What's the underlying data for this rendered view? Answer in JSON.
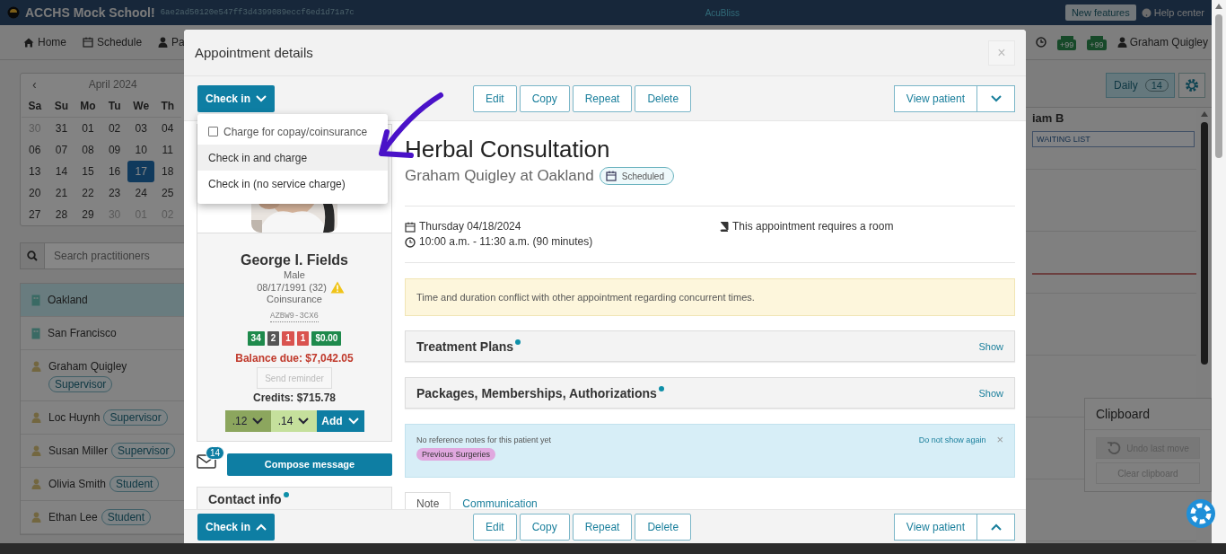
{
  "top_bar": {
    "school": "ACCHS Mock School!",
    "hash": "6ae2ad50120e547ff3d4399089eccf6ed1d71a7c",
    "brand": "AcuBliss",
    "new_features": "New features",
    "help": "Help center"
  },
  "nav": {
    "items": [
      {
        "label": "Home",
        "kind": "home"
      },
      {
        "label": "Schedule",
        "kind": "calendar"
      },
      {
        "label": "Pa",
        "kind": "person"
      }
    ],
    "badges": [
      "+99",
      "+99"
    ],
    "user": "Graham Quigley"
  },
  "calendar": {
    "prev": "‹",
    "month": "April 2024",
    "weekdays": [
      "Sa",
      "Su",
      "Mo",
      "Tu",
      "We",
      "Th"
    ],
    "weeks": [
      [
        {
          "day": "30",
          "muted": true,
          "selected": false
        },
        {
          "day": "31",
          "muted": false,
          "selected": false
        },
        {
          "day": "01",
          "muted": false,
          "selected": false
        },
        {
          "day": "02",
          "muted": false,
          "selected": false
        },
        {
          "day": "03",
          "muted": false,
          "selected": false
        },
        {
          "day": "04",
          "muted": false,
          "selected": false
        }
      ],
      [
        {
          "day": "06",
          "muted": false,
          "selected": false
        },
        {
          "day": "07",
          "muted": false,
          "selected": false
        },
        {
          "day": "08",
          "muted": false,
          "selected": false
        },
        {
          "day": "09",
          "muted": false,
          "selected": false
        },
        {
          "day": "10",
          "muted": false,
          "selected": false
        },
        {
          "day": "11",
          "muted": false,
          "selected": false
        }
      ],
      [
        {
          "day": "13",
          "muted": false,
          "selected": false
        },
        {
          "day": "14",
          "muted": false,
          "selected": false
        },
        {
          "day": "15",
          "muted": false,
          "selected": false
        },
        {
          "day": "16",
          "muted": false,
          "selected": false
        },
        {
          "day": "17",
          "muted": false,
          "selected": true
        },
        {
          "day": "18",
          "muted": false,
          "selected": false
        }
      ],
      [
        {
          "day": "20",
          "muted": false,
          "selected": false
        },
        {
          "day": "21",
          "muted": false,
          "selected": false
        },
        {
          "day": "22",
          "muted": false,
          "selected": false
        },
        {
          "day": "23",
          "muted": false,
          "selected": false
        },
        {
          "day": "24",
          "muted": false,
          "selected": false
        },
        {
          "day": "25",
          "muted": false,
          "selected": false
        }
      ],
      [
        {
          "day": "27",
          "muted": false,
          "selected": false
        },
        {
          "day": "28",
          "muted": false,
          "selected": false
        },
        {
          "day": "29",
          "muted": false,
          "selected": false
        },
        {
          "day": "30",
          "muted": true,
          "selected": false
        },
        {
          "day": "01",
          "muted": true,
          "selected": false
        },
        {
          "day": "02",
          "muted": true,
          "selected": false
        }
      ]
    ]
  },
  "search": {
    "placeholder": "Search practitioners"
  },
  "practitioners": [
    {
      "name": "Oakland",
      "kind": "location",
      "selected": true
    },
    {
      "name": "San Francisco",
      "kind": "location",
      "selected": false
    },
    {
      "name": "Graham Quigley",
      "kind": "person",
      "role": "Supervisor",
      "selected": false
    },
    {
      "name": "Loc Huynh",
      "kind": "person",
      "role": "Supervisor",
      "selected": false
    },
    {
      "name": "Susan Miller",
      "kind": "person",
      "role": "Supervisor",
      "selected": false
    },
    {
      "name": "Olivia Smith",
      "kind": "person",
      "role": "Student",
      "selected": false
    },
    {
      "name": "Ethan Lee",
      "kind": "person",
      "role": "Student",
      "selected": false
    }
  ],
  "schedule": {
    "view": "Daily",
    "count": "14",
    "column": "iam B",
    "entries": [
      "WAITING LIST"
    ]
  },
  "clipboard": {
    "title": "Clipboard",
    "undo": "Undo last move",
    "clear": "Clear clipboard"
  },
  "modal": {
    "title": "Appointment details",
    "close": "×",
    "toolbar": {
      "check_in": "Check in",
      "actions": [
        "Edit",
        "Copy",
        "Repeat",
        "Delete"
      ],
      "view_patient": "View patient"
    },
    "dropdown": [
      {
        "kind": "checkbox",
        "label": "Charge for copay/coinsurance",
        "checked": false
      },
      {
        "kind": "action",
        "label": "Check in and charge",
        "selected": true
      },
      {
        "kind": "action",
        "label": "Check in (no service charge)",
        "selected": false
      }
    ],
    "patient": {
      "name": "George I. Fields",
      "sex": "Male",
      "dob": "08/17/1991 (32)",
      "plan": "Coinsurance",
      "id": "AZBW9-3CX6",
      "badges": [
        {
          "text": "34",
          "color": "#1e8a4c"
        },
        {
          "text": "2",
          "color": "#555555"
        },
        {
          "text": "1",
          "color": "#d9534f"
        },
        {
          "text": "1",
          "color": "#d9534f"
        },
        {
          "text": "$0.00",
          "color": "#1e8a4c"
        }
      ],
      "balance": "Balance due: $7,042.05",
      "send_reminder": "Send reminder",
      "credits": "Credits: $715.78",
      "codes": [
        {
          "label": ".12",
          "color": "#8ca65e"
        },
        {
          "label": ".14",
          "color": "#c5e09c"
        }
      ],
      "add": "Add",
      "messages": "14",
      "compose": "Compose message",
      "contact": "Contact info"
    },
    "appointment": {
      "title": "Herbal Consultation",
      "subtitle": "Graham Quigley at Oakland",
      "status": "Scheduled",
      "date": "Thursday 04/18/2024",
      "time": "10:00 a.m. - 11:30 a.m. (90 minutes)",
      "room": "This appointment requires a room",
      "warning": "Time and duration conflict with other appointment regarding concurrent times.",
      "sections": [
        {
          "title": "Treatment Plans",
          "action": "Show",
          "dot": true
        },
        {
          "title": "Packages, Memberships, Authorizations",
          "action": "Show",
          "dot": true
        }
      ],
      "note": {
        "text": "No reference notes for this patient yet",
        "dismiss": "Do not show again",
        "close": "×",
        "tag": "Previous Surgeries"
      },
      "tabs": [
        {
          "label": "Note",
          "selected": true
        },
        {
          "label": "Communication",
          "selected": false
        }
      ]
    },
    "footer": {
      "check_in": "Check in",
      "actions": [
        "Edit",
        "Copy",
        "Repeat",
        "Delete"
      ],
      "view_patient": "View patient"
    }
  }
}
